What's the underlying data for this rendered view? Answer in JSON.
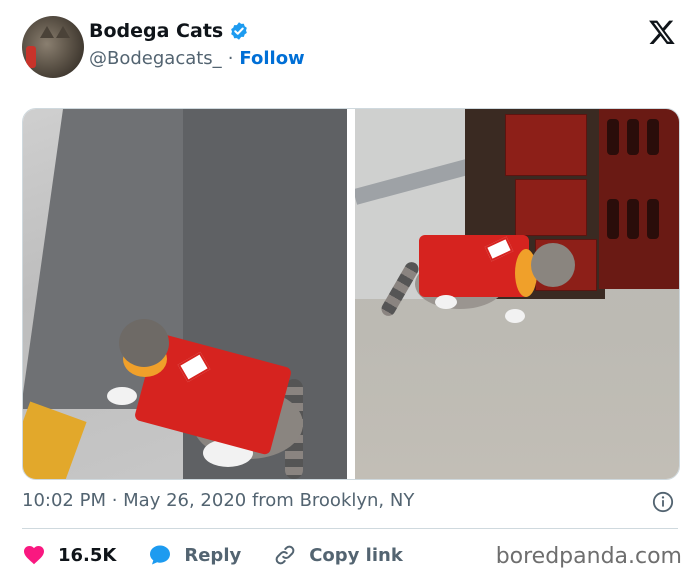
{
  "user": {
    "display_name": "Bodega Cats",
    "handle": "@Bodegacats_",
    "separator": "·",
    "follow_label": "Follow",
    "verified": true
  },
  "icons": {
    "verified": "verified-badge-icon",
    "platform": "x-logo-icon",
    "info": "info-icon",
    "like": "heart-icon",
    "reply": "speech-bubble-icon",
    "copy": "link-icon"
  },
  "tweet": {
    "timestamp": "10:02 PM · May 26, 2020 from Brooklyn, NY"
  },
  "actions": {
    "likes": "16.5K",
    "reply_label": "Reply",
    "copy_label": "Copy link"
  },
  "watermark": "boredpanda.com",
  "colors": {
    "accent": "#006fd6",
    "verified": "#1d9bf0",
    "like": "#f91880",
    "muted": "#536471"
  }
}
